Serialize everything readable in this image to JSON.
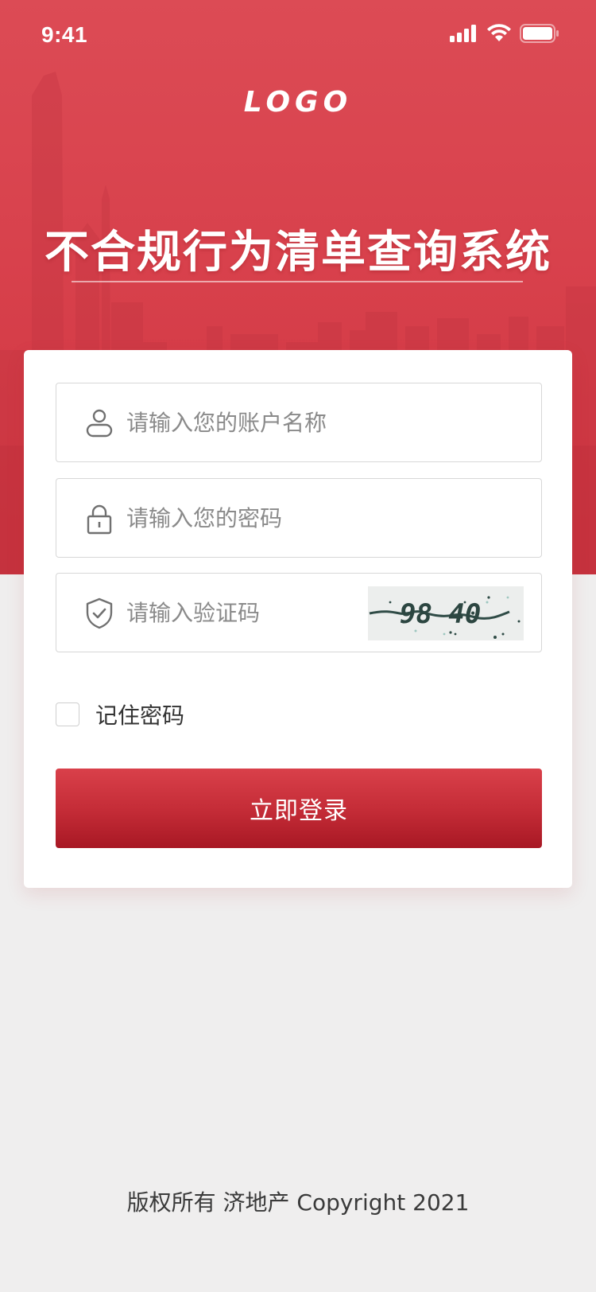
{
  "status_bar": {
    "time": "9:41",
    "icons": [
      "signal-icon",
      "wifi-icon",
      "battery-icon"
    ]
  },
  "header": {
    "logo": "LOGO",
    "title": "不合规行为清单查询系统"
  },
  "form": {
    "username": {
      "placeholder": "请输入您的账户名称",
      "value": "",
      "icon": "user-icon"
    },
    "password": {
      "placeholder": "请输入您的密码",
      "value": "",
      "icon": "lock-icon"
    },
    "captcha": {
      "placeholder": "请输入验证码",
      "value": "",
      "icon": "shield-check-icon",
      "image_text": "98 40"
    },
    "remember_label": "记住密码",
    "remember_checked": false,
    "login_label": "立即登录"
  },
  "footer": {
    "copyright": "版权所有 济地产 Copyright 2021"
  },
  "colors": {
    "brand_red": "#d8414c",
    "button_top": "#d9404a",
    "button_bottom": "#a81824",
    "background": "#efeeee"
  }
}
